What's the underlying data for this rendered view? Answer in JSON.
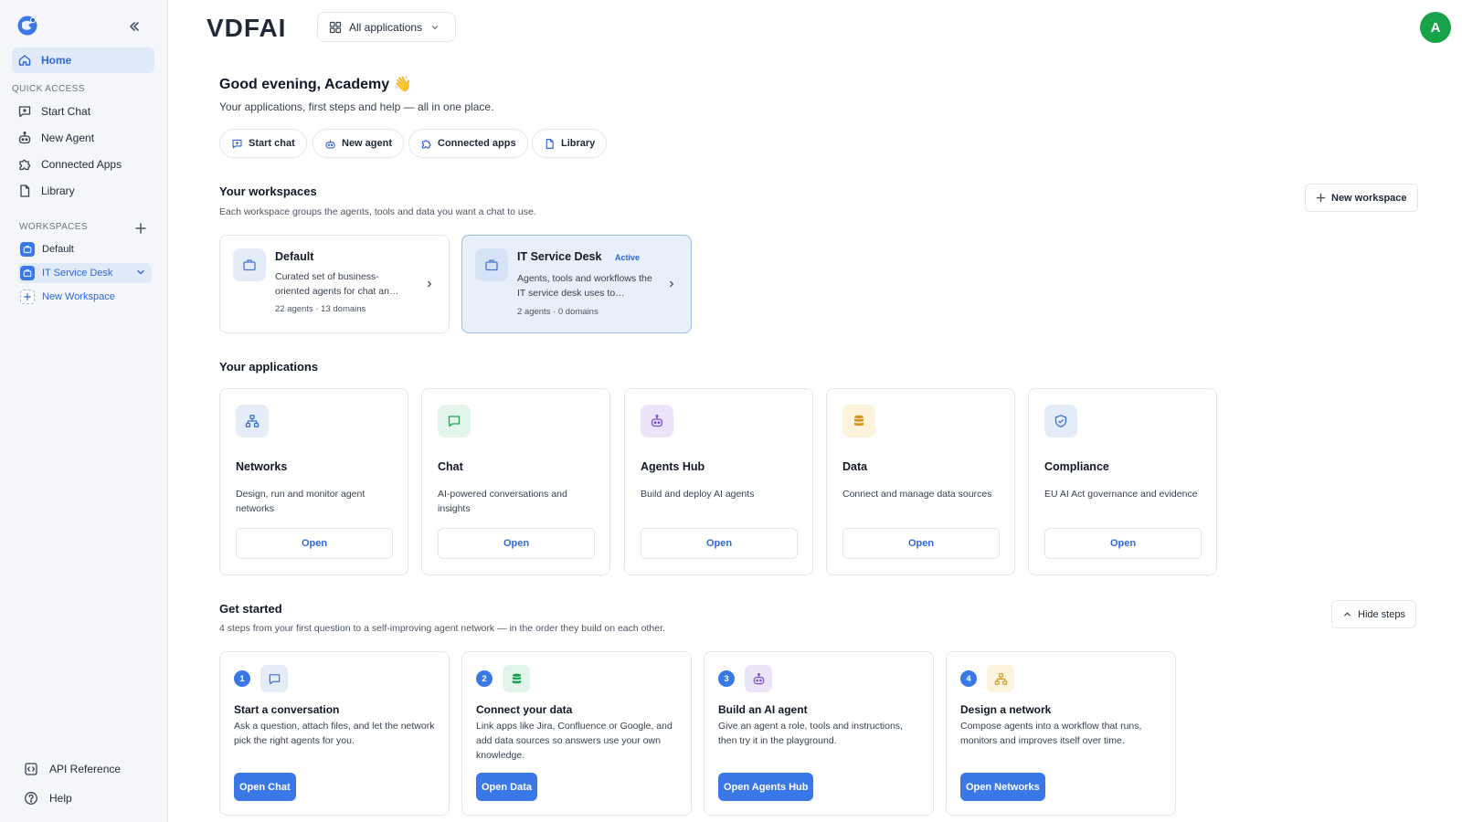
{
  "sidebar": {
    "home": "Home",
    "quick_access_title": "QUICK ACCESS",
    "quick_items": [
      "Start Chat",
      "New Agent",
      "Connected Apps",
      "Library"
    ],
    "workspaces_title": "WORKSPACES",
    "workspaces": [
      "Default",
      "IT Service Desk"
    ],
    "new_workspace": "New Workspace",
    "bottom": [
      "API Reference",
      "Help"
    ]
  },
  "header": {
    "brand": "VDFAI",
    "app_switcher": "All applications",
    "avatar_initial": "A"
  },
  "hero": {
    "greeting": "Good evening, Academy 👋",
    "subtitle": "Your applications, first steps and help — all in one place.",
    "quick_actions": [
      "Start chat",
      "New agent",
      "Connected apps",
      "Library"
    ]
  },
  "workspaces": {
    "title": "Your workspaces",
    "description": "Each workspace groups the agents, tools and data you want a chat to use.",
    "new_button": "New workspace",
    "cards": [
      {
        "name": "Default",
        "badge": "",
        "description": "Curated set of business-oriented agents for chat an…",
        "meta": "22 agents · 13 domains"
      },
      {
        "name": "IT Service Desk",
        "badge": "Active",
        "description": "Agents, tools and workflows the IT service desk uses to…",
        "meta": "2 agents · 0 domains"
      }
    ]
  },
  "applications": {
    "title": "Your applications",
    "open_label": "Open",
    "cards": [
      {
        "name": "Networks",
        "description": "Design, run and monitor agent networks",
        "icon": "network-icon"
      },
      {
        "name": "Chat",
        "description": "AI-powered conversations and insights",
        "icon": "chat-icon"
      },
      {
        "name": "Agents Hub",
        "description": "Build and deploy AI agents",
        "icon": "robot-icon"
      },
      {
        "name": "Data",
        "description": "Connect and manage data sources",
        "icon": "database-icon"
      },
      {
        "name": "Compliance",
        "description": "EU AI Act governance and evidence",
        "icon": "shield-icon"
      }
    ]
  },
  "get_started": {
    "title": "Get started",
    "description": "4 steps from your first question to a self-improving agent network — in the order they build on each other.",
    "hide_button": "Hide steps",
    "steps": [
      {
        "number": "1",
        "title": "Start a conversation",
        "description": "Ask a question, attach files, and let the network pick the right agents for you.",
        "button": "Open Chat"
      },
      {
        "number": "2",
        "title": "Connect your data",
        "description": "Link apps like Jira, Confluence or Google, and add data sources so answers use your own knowledge.",
        "button": "Open Data"
      },
      {
        "number": "3",
        "title": "Build an AI agent",
        "description": "Give an agent a role, tools and instructions, then try it in the playground.",
        "button": "Open Agents Hub"
      },
      {
        "number": "4",
        "title": "Design a network",
        "description": "Compose agents into a workflow that runs, monitors and improves itself over time.",
        "button": "Open Networks"
      }
    ]
  },
  "colors": {
    "accent": "#3b78e7",
    "accent_text": "#2f67d8",
    "avatar": "#16a34a",
    "sidebar_bg": "#f4f6f9",
    "active_bg": "#e0eaf8"
  }
}
